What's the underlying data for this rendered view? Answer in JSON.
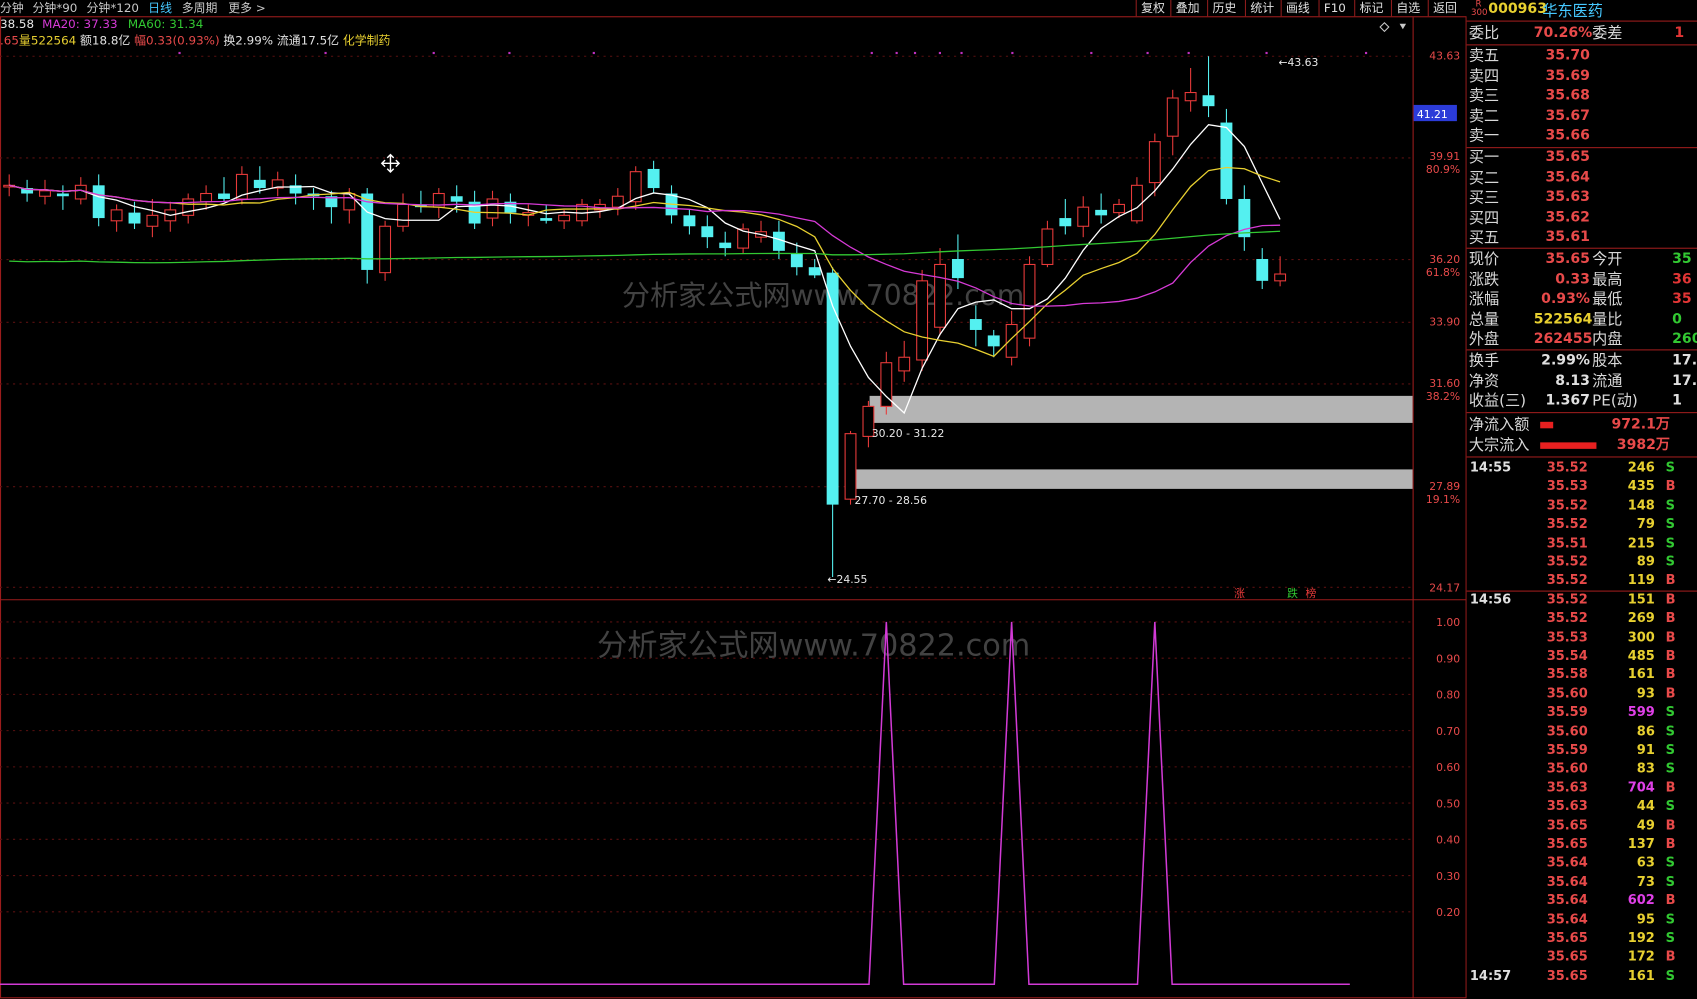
{
  "topbar": {
    "tabs": [
      "分钟",
      "分钟*90",
      "分钟*120",
      "日线",
      "多周期",
      "更多 >"
    ],
    "active_tab": "日线",
    "buttons": [
      "复权",
      "叠加",
      "历史",
      "统计",
      "画线",
      "F10",
      "标记",
      "自选",
      "返回"
    ]
  },
  "header_info": {
    "close_partial": "38.58",
    "ma20": "MA20: 37.33",
    "ma60": "MA60: 31.34",
    "prefix": ".65",
    "volume": "量522564",
    "amount": "额18.8亿",
    "change": "幅0.33(0.93%)",
    "turnover": "换2.99%",
    "float_cap": "流通17.5亿",
    "sector": "化学制药"
  },
  "price_axis": {
    "labels": [
      "43.63",
      "39.91",
      "80.9%",
      "36.20",
      "61.8%",
      "33.90",
      "31.60",
      "38.2%",
      "27.89",
      "19.1%",
      "24.17"
    ],
    "current_tag": "41.21",
    "high_note": "43.63",
    "low_note": "24.55",
    "zone_upper_label": "30.20 - 31.22",
    "zone_lower_label": "27.70 - 28.56",
    "signal_up": "涨",
    "signal_down": "跌",
    "signal_rank": "榜"
  },
  "watermark": "分析家公式网www.70822.com",
  "indicator_axis": {
    "labels": [
      "1.00",
      "0.90",
      "0.80",
      "0.70",
      "0.60",
      "0.50",
      "0.40",
      "0.30",
      "0.20"
    ]
  },
  "colors": {
    "up": "#e83a3a",
    "down": "#54f0f0",
    "ma_white": "#ffffff",
    "ma_yellow": "#e8d030",
    "ma_magenta": "#d63ad6",
    "ma_green": "#32c832",
    "zone": "#b4b4b4",
    "indicator": "#d23ad6"
  },
  "chart_data": {
    "type": "candlestick",
    "ylim": [
      24.17,
      43.63
    ],
    "candles": [
      {
        "o": 38.9,
        "h": 39.3,
        "l": 38.5,
        "c": 38.9
      },
      {
        "o": 38.8,
        "h": 39.1,
        "l": 38.3,
        "c": 38.6
      },
      {
        "o": 38.5,
        "h": 39.1,
        "l": 38.2,
        "c": 38.7
      },
      {
        "o": 38.6,
        "h": 38.9,
        "l": 38.0,
        "c": 38.5
      },
      {
        "o": 38.4,
        "h": 39.2,
        "l": 38.2,
        "c": 38.9
      },
      {
        "o": 38.9,
        "h": 39.3,
        "l": 37.4,
        "c": 37.7
      },
      {
        "o": 37.6,
        "h": 38.2,
        "l": 37.2,
        "c": 38.0
      },
      {
        "o": 37.9,
        "h": 38.3,
        "l": 37.3,
        "c": 37.5
      },
      {
        "o": 37.4,
        "h": 38.4,
        "l": 37.0,
        "c": 37.8
      },
      {
        "o": 37.6,
        "h": 38.3,
        "l": 37.2,
        "c": 38.0
      },
      {
        "o": 37.8,
        "h": 38.6,
        "l": 37.5,
        "c": 38.4
      },
      {
        "o": 38.3,
        "h": 38.9,
        "l": 38.0,
        "c": 38.6
      },
      {
        "o": 38.6,
        "h": 39.2,
        "l": 38.3,
        "c": 38.4
      },
      {
        "o": 38.4,
        "h": 39.6,
        "l": 38.2,
        "c": 39.3
      },
      {
        "o": 39.1,
        "h": 39.6,
        "l": 38.6,
        "c": 38.8
      },
      {
        "o": 38.8,
        "h": 39.4,
        "l": 38.5,
        "c": 39.1
      },
      {
        "o": 38.9,
        "h": 39.3,
        "l": 38.2,
        "c": 38.6
      },
      {
        "o": 38.6,
        "h": 38.8,
        "l": 38.0,
        "c": 38.5
      },
      {
        "o": 38.5,
        "h": 38.7,
        "l": 37.5,
        "c": 38.1
      },
      {
        "o": 38.0,
        "h": 38.8,
        "l": 37.5,
        "c": 38.6
      },
      {
        "o": 38.6,
        "h": 38.8,
        "l": 35.3,
        "c": 35.8
      },
      {
        "o": 35.7,
        "h": 37.6,
        "l": 35.4,
        "c": 37.4
      },
      {
        "o": 37.4,
        "h": 38.6,
        "l": 37.2,
        "c": 38.2
      },
      {
        "o": 38.2,
        "h": 38.7,
        "l": 37.9,
        "c": 38.1
      },
      {
        "o": 38.1,
        "h": 38.8,
        "l": 37.7,
        "c": 38.6
      },
      {
        "o": 38.5,
        "h": 38.9,
        "l": 37.9,
        "c": 38.3
      },
      {
        "o": 38.3,
        "h": 38.7,
        "l": 37.3,
        "c": 37.5
      },
      {
        "o": 37.7,
        "h": 38.7,
        "l": 37.4,
        "c": 38.4
      },
      {
        "o": 38.3,
        "h": 38.6,
        "l": 37.5,
        "c": 37.9
      },
      {
        "o": 37.8,
        "h": 38.2,
        "l": 37.4,
        "c": 37.9
      },
      {
        "o": 37.7,
        "h": 38.2,
        "l": 37.5,
        "c": 37.6
      },
      {
        "o": 37.6,
        "h": 38.0,
        "l": 37.3,
        "c": 37.8
      },
      {
        "o": 37.6,
        "h": 38.4,
        "l": 37.4,
        "c": 38.2
      },
      {
        "o": 38.0,
        "h": 38.4,
        "l": 37.7,
        "c": 38.2
      },
      {
        "o": 38.1,
        "h": 38.8,
        "l": 37.8,
        "c": 38.5
      },
      {
        "o": 38.3,
        "h": 39.6,
        "l": 38.0,
        "c": 39.4
      },
      {
        "o": 39.5,
        "h": 39.8,
        "l": 38.6,
        "c": 38.8
      },
      {
        "o": 38.6,
        "h": 38.9,
        "l": 37.5,
        "c": 37.8
      },
      {
        "o": 37.8,
        "h": 38.0,
        "l": 37.1,
        "c": 37.4
      },
      {
        "o": 37.4,
        "h": 37.8,
        "l": 36.6,
        "c": 37.0
      },
      {
        "o": 36.8,
        "h": 37.2,
        "l": 36.3,
        "c": 36.6
      },
      {
        "o": 36.6,
        "h": 37.5,
        "l": 36.4,
        "c": 37.3
      },
      {
        "o": 37.0,
        "h": 37.6,
        "l": 36.8,
        "c": 37.2
      },
      {
        "o": 37.2,
        "h": 37.6,
        "l": 36.2,
        "c": 36.5
      },
      {
        "o": 36.4,
        "h": 36.8,
        "l": 35.6,
        "c": 35.9
      },
      {
        "o": 35.9,
        "h": 36.2,
        "l": 35.5,
        "c": 35.6
      },
      {
        "o": 35.7,
        "h": 35.9,
        "l": 24.55,
        "c": 27.2
      },
      {
        "o": 27.4,
        "h": 29.9,
        "l": 27.2,
        "c": 29.8
      },
      {
        "o": 29.7,
        "h": 31.0,
        "l": 29.3,
        "c": 30.8
      },
      {
        "o": 30.8,
        "h": 32.8,
        "l": 30.5,
        "c": 32.4
      },
      {
        "o": 32.1,
        "h": 33.2,
        "l": 31.7,
        "c": 32.6
      },
      {
        "o": 32.5,
        "h": 35.8,
        "l": 32.1,
        "c": 35.4
      },
      {
        "o": 33.7,
        "h": 36.6,
        "l": 33.4,
        "c": 36.0
      },
      {
        "o": 36.2,
        "h": 37.1,
        "l": 35.1,
        "c": 35.5
      },
      {
        "o": 34.0,
        "h": 34.5,
        "l": 33.0,
        "c": 33.6
      },
      {
        "o": 33.4,
        "h": 33.6,
        "l": 32.6,
        "c": 33.0
      },
      {
        "o": 32.6,
        "h": 34.3,
        "l": 32.3,
        "c": 33.8
      },
      {
        "o": 33.3,
        "h": 36.3,
        "l": 33.0,
        "c": 36.0
      },
      {
        "o": 36.0,
        "h": 37.6,
        "l": 35.9,
        "c": 37.3
      },
      {
        "o": 37.7,
        "h": 38.4,
        "l": 37.1,
        "c": 37.4
      },
      {
        "o": 37.4,
        "h": 38.5,
        "l": 37.0,
        "c": 38.1
      },
      {
        "o": 38.0,
        "h": 38.6,
        "l": 37.5,
        "c": 37.8
      },
      {
        "o": 37.9,
        "h": 38.4,
        "l": 37.7,
        "c": 38.2
      },
      {
        "o": 37.6,
        "h": 39.2,
        "l": 37.5,
        "c": 38.9
      },
      {
        "o": 39.0,
        "h": 40.8,
        "l": 38.5,
        "c": 40.5
      },
      {
        "o": 40.7,
        "h": 42.4,
        "l": 40.0,
        "c": 42.1
      },
      {
        "o": 42.0,
        "h": 43.2,
        "l": 41.6,
        "c": 42.3
      },
      {
        "o": 42.2,
        "h": 43.63,
        "l": 41.4,
        "c": 41.8
      },
      {
        "o": 41.2,
        "h": 41.7,
        "l": 38.2,
        "c": 38.4
      },
      {
        "o": 38.4,
        "h": 38.9,
        "l": 36.5,
        "c": 37.0
      },
      {
        "o": 36.2,
        "h": 36.6,
        "l": 35.1,
        "c": 35.4
      },
      {
        "o": 35.4,
        "h": 36.3,
        "l": 35.2,
        "c": 35.65
      }
    ],
    "indicator": {
      "ylim": [
        0,
        1.0
      ],
      "spikes_at_candle": [
        49,
        56,
        64
      ]
    }
  },
  "right_panel": {
    "code": "000963",
    "name": "华东医药",
    "badge_top": "R",
    "badge_bottom": "300",
    "weibi_label": "委比",
    "weibi_value": "70.26%",
    "weicha_label": "委差",
    "weicha_value": "1",
    "asks": [
      {
        "label": "卖五",
        "price": "35.70"
      },
      {
        "label": "卖四",
        "price": "35.69"
      },
      {
        "label": "卖三",
        "price": "35.68"
      },
      {
        "label": "卖二",
        "price": "35.67"
      },
      {
        "label": "卖一",
        "price": "35.66"
      }
    ],
    "bids": [
      {
        "label": "买一",
        "price": "35.65"
      },
      {
        "label": "买二",
        "price": "35.64"
      },
      {
        "label": "买三",
        "price": "35.63"
      },
      {
        "label": "买四",
        "price": "35.62"
      },
      {
        "label": "买五",
        "price": "35.61"
      }
    ],
    "quote": [
      {
        "l": "现价",
        "v": "35.65",
        "c": "#e84a4a",
        "l2": "今开",
        "v2": "35"
      },
      {
        "l": "涨跌",
        "v": "0.33",
        "c": "#e84a4a",
        "l2": "最高",
        "v2": "36"
      },
      {
        "l": "涨幅",
        "v": "0.93%",
        "c": "#e84a4a",
        "l2": "最低",
        "v2": "35"
      },
      {
        "l": "总量",
        "v": "522564",
        "c": "#e8d030",
        "l2": "量比",
        "v2": "0"
      },
      {
        "l": "外盘",
        "v": "262455",
        "c": "#e84a4a",
        "l2": "内盘",
        "v2": "260"
      }
    ],
    "stats": [
      {
        "l": "换手",
        "v": "2.99%",
        "c": "#e0e0e0",
        "l2": "股本",
        "v2": "17."
      },
      {
        "l": "净资",
        "v": "8.13",
        "c": "#e0e0e0",
        "l2": "流通",
        "v2": "17."
      },
      {
        "l": "收益(三)",
        "v": "1.367",
        "c": "#e0e0e0",
        "l2": "PE(动)",
        "v2": "1"
      }
    ],
    "flow": [
      {
        "l": "净流入额",
        "v": "972.1万"
      },
      {
        "l": "大宗流入",
        "v": "3982万"
      }
    ],
    "ticks": [
      {
        "t": "14:55",
        "p": "35.52",
        "v": "246",
        "d": "S"
      },
      {
        "t": "",
        "p": "35.53",
        "v": "435",
        "d": "B"
      },
      {
        "t": "",
        "p": "35.52",
        "v": "148",
        "d": "S"
      },
      {
        "t": "",
        "p": "35.52",
        "v": "79",
        "d": "S"
      },
      {
        "t": "",
        "p": "35.51",
        "v": "215",
        "d": "S"
      },
      {
        "t": "",
        "p": "35.52",
        "v": "89",
        "d": "S"
      },
      {
        "t": "",
        "p": "35.52",
        "v": "119",
        "d": "B"
      },
      {
        "t": "14:56",
        "p": "35.52",
        "v": "151",
        "d": "B"
      },
      {
        "t": "",
        "p": "35.52",
        "v": "269",
        "d": "B"
      },
      {
        "t": "",
        "p": "35.53",
        "v": "300",
        "d": "B"
      },
      {
        "t": "",
        "p": "35.54",
        "v": "485",
        "d": "B"
      },
      {
        "t": "",
        "p": "35.58",
        "v": "161",
        "d": "B"
      },
      {
        "t": "",
        "p": "35.60",
        "v": "93",
        "d": "B"
      },
      {
        "t": "",
        "p": "35.59",
        "v": "599",
        "d": "S"
      },
      {
        "t": "",
        "p": "35.60",
        "v": "86",
        "d": "S"
      },
      {
        "t": "",
        "p": "35.59",
        "v": "91",
        "d": "S"
      },
      {
        "t": "",
        "p": "35.60",
        "v": "83",
        "d": "S"
      },
      {
        "t": "",
        "p": "35.63",
        "v": "704",
        "d": "B"
      },
      {
        "t": "",
        "p": "35.63",
        "v": "44",
        "d": "S"
      },
      {
        "t": "",
        "p": "35.65",
        "v": "49",
        "d": "B"
      },
      {
        "t": "",
        "p": "35.65",
        "v": "137",
        "d": "B"
      },
      {
        "t": "",
        "p": "35.64",
        "v": "63",
        "d": "S"
      },
      {
        "t": "",
        "p": "35.64",
        "v": "73",
        "d": "S"
      },
      {
        "t": "",
        "p": "35.64",
        "v": "602",
        "d": "B"
      },
      {
        "t": "",
        "p": "35.64",
        "v": "95",
        "d": "S"
      },
      {
        "t": "",
        "p": "35.65",
        "v": "192",
        "d": "S"
      },
      {
        "t": "",
        "p": "35.65",
        "v": "172",
        "d": "B"
      },
      {
        "t": "14:57",
        "p": "35.65",
        "v": "161",
        "d": "S"
      }
    ]
  }
}
